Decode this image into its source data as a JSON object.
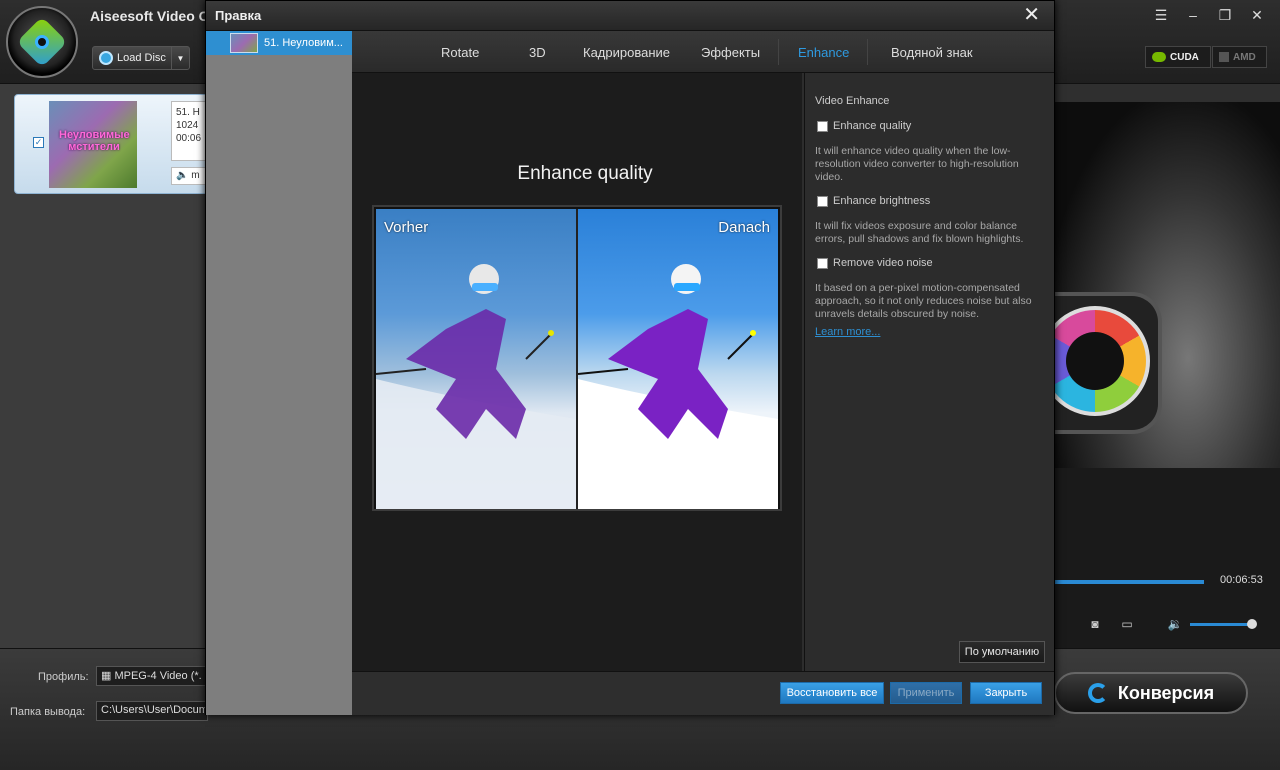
{
  "app": {
    "title": "Aiseesoft Video C",
    "load_disc_label": "Load Disc",
    "window_controls": [
      "menu-icon",
      "minimize-icon",
      "restore-icon",
      "close-icon"
    ],
    "gpu": {
      "cuda": "CUDA",
      "amd": "AMD"
    },
    "file": {
      "checked": "✓",
      "thumb_text": "Неуловимые мстители",
      "meta_lines": [
        "51. Н",
        "1024",
        "00:06"
      ],
      "audio": "m"
    },
    "preview": {
      "time": "00:06:53",
      "progress_percent": 100,
      "volume_percent": 95
    },
    "bottom": {
      "profile_label": "Профиль:",
      "profile_value": "MPEG-4 Video (*.",
      "output_label": "Папка вывода:",
      "output_value": "C:\\Users\\User\\Docume",
      "convert_label": "Конверсия"
    }
  },
  "dialog": {
    "title": "Правка",
    "sidebar_item": "51. Неуловим...",
    "tabs": [
      {
        "label": "Rotate",
        "active": false
      },
      {
        "label": "3D",
        "active": false
      },
      {
        "label": "Кадрирование",
        "active": false
      },
      {
        "label": "Эффекты",
        "active": false
      },
      {
        "label": "Enhance",
        "active": true
      },
      {
        "label": "Водяной знак",
        "active": false
      }
    ],
    "main": {
      "heading": "Enhance quality",
      "before_label": "Vorher",
      "after_label": "Danach"
    },
    "right": {
      "section_title": "Video Enhance",
      "options": [
        {
          "label": "Enhance quality",
          "checked": false,
          "desc": "It will enhance video quality when the low-resolution video converter to high-resolution video."
        },
        {
          "label": "Enhance brightness",
          "checked": false,
          "desc": "It will fix videos exposure and color balance errors, pull shadows and fix blown highlights."
        },
        {
          "label": "Remove video noise",
          "checked": false,
          "desc": "It based on a per-pixel motion-compensated approach, so it not only reduces noise but also unravels details obscured by noise."
        }
      ],
      "learn_more": "Learn more...",
      "default_button": "По умолчанию"
    },
    "footer": {
      "restore_all": "Восстановить все",
      "apply": "Применить",
      "close": "Закрыть"
    }
  },
  "colors": {
    "accent": "#2e8fd1",
    "tab_active": "#2e9ae0"
  }
}
